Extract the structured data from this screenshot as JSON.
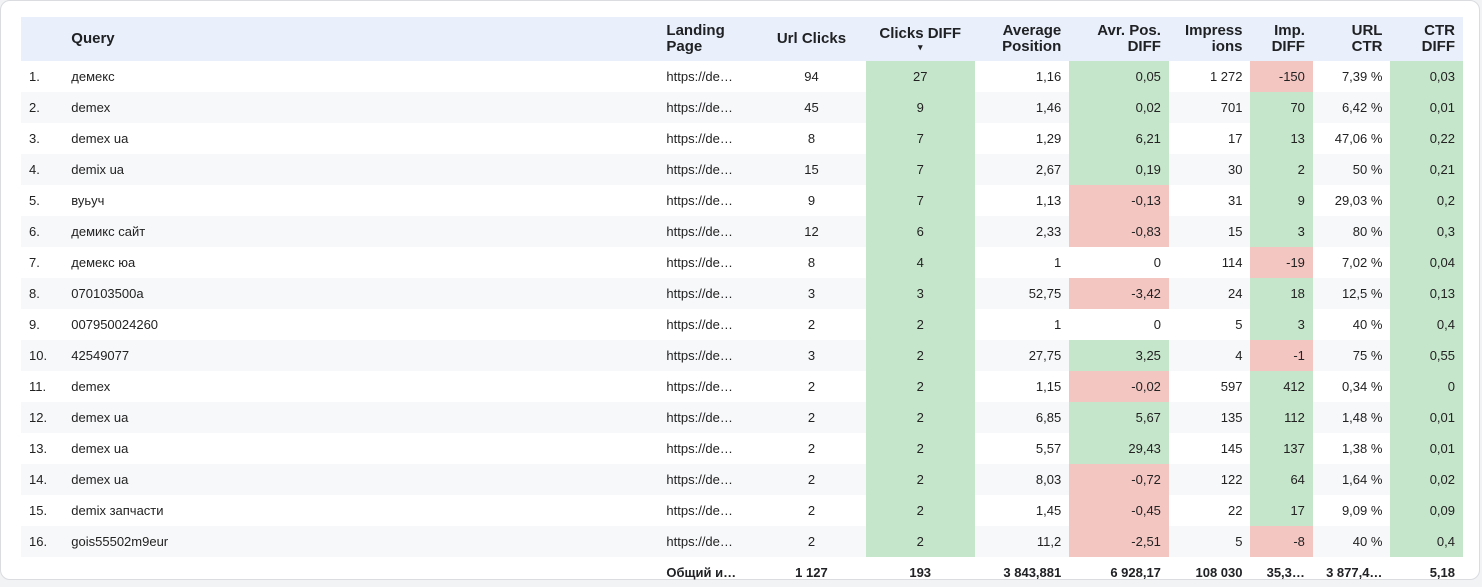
{
  "columns": {
    "query": "Query",
    "landing_page": "Landing Page",
    "url_clicks": "Url Clicks",
    "clicks_diff": "Clicks DIFF",
    "avg_position": "Average Position",
    "avg_pos_diff": "Avr. Pos. DIFF",
    "impressions": "Impress ions",
    "imp_diff": "Imp. DIFF",
    "url_ctr": "URL CTR",
    "ctr_diff": "CTR DIFF"
  },
  "sort_indicator": "▾",
  "colors": {
    "positive": "#c6e6cb",
    "negative": "#f4c6c2",
    "header_bg": "#e9f0fb"
  },
  "rows": [
    {
      "n": "1.",
      "query": "демекс",
      "url": "https://de…",
      "clicks": "94",
      "clicks_diff": "27",
      "clicks_diff_s": "pos",
      "avg_pos": "1,16",
      "avg_pos_diff": "0,05",
      "avg_pos_diff_s": "pos",
      "impr": "1 272",
      "imp_diff": "-150",
      "imp_diff_s": "neg",
      "ctr": "7,39 %",
      "ctr_diff": "0,03",
      "ctr_diff_s": "pos"
    },
    {
      "n": "2.",
      "query": "demex",
      "url": "https://de…",
      "clicks": "45",
      "clicks_diff": "9",
      "clicks_diff_s": "pos",
      "avg_pos": "1,46",
      "avg_pos_diff": "0,02",
      "avg_pos_diff_s": "pos",
      "impr": "701",
      "imp_diff": "70",
      "imp_diff_s": "pos",
      "ctr": "6,42 %",
      "ctr_diff": "0,01",
      "ctr_diff_s": "pos"
    },
    {
      "n": "3.",
      "query": "demex ua",
      "url": "https://de…",
      "clicks": "8",
      "clicks_diff": "7",
      "clicks_diff_s": "pos",
      "avg_pos": "1,29",
      "avg_pos_diff": "6,21",
      "avg_pos_diff_s": "pos",
      "impr": "17",
      "imp_diff": "13",
      "imp_diff_s": "pos",
      "ctr": "47,06 %",
      "ctr_diff": "0,22",
      "ctr_diff_s": "pos"
    },
    {
      "n": "4.",
      "query": "demix ua",
      "url": "https://de…",
      "clicks": "15",
      "clicks_diff": "7",
      "clicks_diff_s": "pos",
      "avg_pos": "2,67",
      "avg_pos_diff": "0,19",
      "avg_pos_diff_s": "pos",
      "impr": "30",
      "imp_diff": "2",
      "imp_diff_s": "pos",
      "ctr": "50 %",
      "ctr_diff": "0,21",
      "ctr_diff_s": "pos"
    },
    {
      "n": "5.",
      "query": "вуьуч",
      "url": "https://de…",
      "clicks": "9",
      "clicks_diff": "7",
      "clicks_diff_s": "pos",
      "avg_pos": "1,13",
      "avg_pos_diff": "-0,13",
      "avg_pos_diff_s": "neg",
      "impr": "31",
      "imp_diff": "9",
      "imp_diff_s": "pos",
      "ctr": "29,03 %",
      "ctr_diff": "0,2",
      "ctr_diff_s": "pos"
    },
    {
      "n": "6.",
      "query": "демикс сайт",
      "url": "https://de…",
      "clicks": "12",
      "clicks_diff": "6",
      "clicks_diff_s": "pos",
      "avg_pos": "2,33",
      "avg_pos_diff": "-0,83",
      "avg_pos_diff_s": "neg",
      "impr": "15",
      "imp_diff": "3",
      "imp_diff_s": "pos",
      "ctr": "80 %",
      "ctr_diff": "0,3",
      "ctr_diff_s": "pos"
    },
    {
      "n": "7.",
      "query": "демекс юа",
      "url": "https://de…",
      "clicks": "8",
      "clicks_diff": "4",
      "clicks_diff_s": "pos",
      "avg_pos": "1",
      "avg_pos_diff": "0",
      "avg_pos_diff_s": "none",
      "impr": "114",
      "imp_diff": "-19",
      "imp_diff_s": "neg",
      "ctr": "7,02 %",
      "ctr_diff": "0,04",
      "ctr_diff_s": "pos"
    },
    {
      "n": "8.",
      "query": "070103500a",
      "url": "https://de…",
      "clicks": "3",
      "clicks_diff": "3",
      "clicks_diff_s": "pos",
      "avg_pos": "52,75",
      "avg_pos_diff": "-3,42",
      "avg_pos_diff_s": "neg",
      "impr": "24",
      "imp_diff": "18",
      "imp_diff_s": "pos",
      "ctr": "12,5 %",
      "ctr_diff": "0,13",
      "ctr_diff_s": "pos"
    },
    {
      "n": "9.",
      "query": "007950024260",
      "url": "https://de…",
      "clicks": "2",
      "clicks_diff": "2",
      "clicks_diff_s": "pos",
      "avg_pos": "1",
      "avg_pos_diff": "0",
      "avg_pos_diff_s": "none",
      "impr": "5",
      "imp_diff": "3",
      "imp_diff_s": "pos",
      "ctr": "40 %",
      "ctr_diff": "0,4",
      "ctr_diff_s": "pos"
    },
    {
      "n": "10.",
      "query": "42549077",
      "url": "https://de…",
      "clicks": "3",
      "clicks_diff": "2",
      "clicks_diff_s": "pos",
      "avg_pos": "27,75",
      "avg_pos_diff": "3,25",
      "avg_pos_diff_s": "pos",
      "impr": "4",
      "imp_diff": "-1",
      "imp_diff_s": "neg",
      "ctr": "75 %",
      "ctr_diff": "0,55",
      "ctr_diff_s": "pos"
    },
    {
      "n": "11.",
      "query": "demex",
      "url": "https://de…",
      "clicks": "2",
      "clicks_diff": "2",
      "clicks_diff_s": "pos",
      "avg_pos": "1,15",
      "avg_pos_diff": "-0,02",
      "avg_pos_diff_s": "neg",
      "impr": "597",
      "imp_diff": "412",
      "imp_diff_s": "pos",
      "ctr": "0,34 %",
      "ctr_diff": "0",
      "ctr_diff_s": "pos"
    },
    {
      "n": "12.",
      "query": "demex ua",
      "url": "https://de…",
      "clicks": "2",
      "clicks_diff": "2",
      "clicks_diff_s": "pos",
      "avg_pos": "6,85",
      "avg_pos_diff": "5,67",
      "avg_pos_diff_s": "pos",
      "impr": "135",
      "imp_diff": "112",
      "imp_diff_s": "pos",
      "ctr": "1,48 %",
      "ctr_diff": "0,01",
      "ctr_diff_s": "pos"
    },
    {
      "n": "13.",
      "query": "demex ua",
      "url": "https://de…",
      "clicks": "2",
      "clicks_diff": "2",
      "clicks_diff_s": "pos",
      "avg_pos": "5,57",
      "avg_pos_diff": "29,43",
      "avg_pos_diff_s": "pos",
      "impr": "145",
      "imp_diff": "137",
      "imp_diff_s": "pos",
      "ctr": "1,38 %",
      "ctr_diff": "0,01",
      "ctr_diff_s": "pos"
    },
    {
      "n": "14.",
      "query": "demex ua",
      "url": "https://de…",
      "clicks": "2",
      "clicks_diff": "2",
      "clicks_diff_s": "pos",
      "avg_pos": "8,03",
      "avg_pos_diff": "-0,72",
      "avg_pos_diff_s": "neg",
      "impr": "122",
      "imp_diff": "64",
      "imp_diff_s": "pos",
      "ctr": "1,64 %",
      "ctr_diff": "0,02",
      "ctr_diff_s": "pos"
    },
    {
      "n": "15.",
      "query": "demix запчасти",
      "url": "https://de…",
      "clicks": "2",
      "clicks_diff": "2",
      "clicks_diff_s": "pos",
      "avg_pos": "1,45",
      "avg_pos_diff": "-0,45",
      "avg_pos_diff_s": "neg",
      "impr": "22",
      "imp_diff": "17",
      "imp_diff_s": "pos",
      "ctr": "9,09 %",
      "ctr_diff": "0,09",
      "ctr_diff_s": "pos"
    },
    {
      "n": "16.",
      "query": "gois55502m9eur",
      "url": "https://de…",
      "clicks": "2",
      "clicks_diff": "2",
      "clicks_diff_s": "pos",
      "avg_pos": "11,2",
      "avg_pos_diff": "-2,51",
      "avg_pos_diff_s": "neg",
      "impr": "5",
      "imp_diff": "-8",
      "imp_diff_s": "neg",
      "ctr": "40 %",
      "ctr_diff": "0,4",
      "ctr_diff_s": "pos"
    }
  ],
  "totals": {
    "label": "Общий и…",
    "clicks": "1 127",
    "clicks_diff": "193",
    "avg_pos": "3 843,881",
    "avg_pos_diff": "6 928,17",
    "impr": "108 030",
    "imp_diff": "35,3…",
    "ctr": "3 877,4…",
    "ctr_diff": "5,18"
  }
}
